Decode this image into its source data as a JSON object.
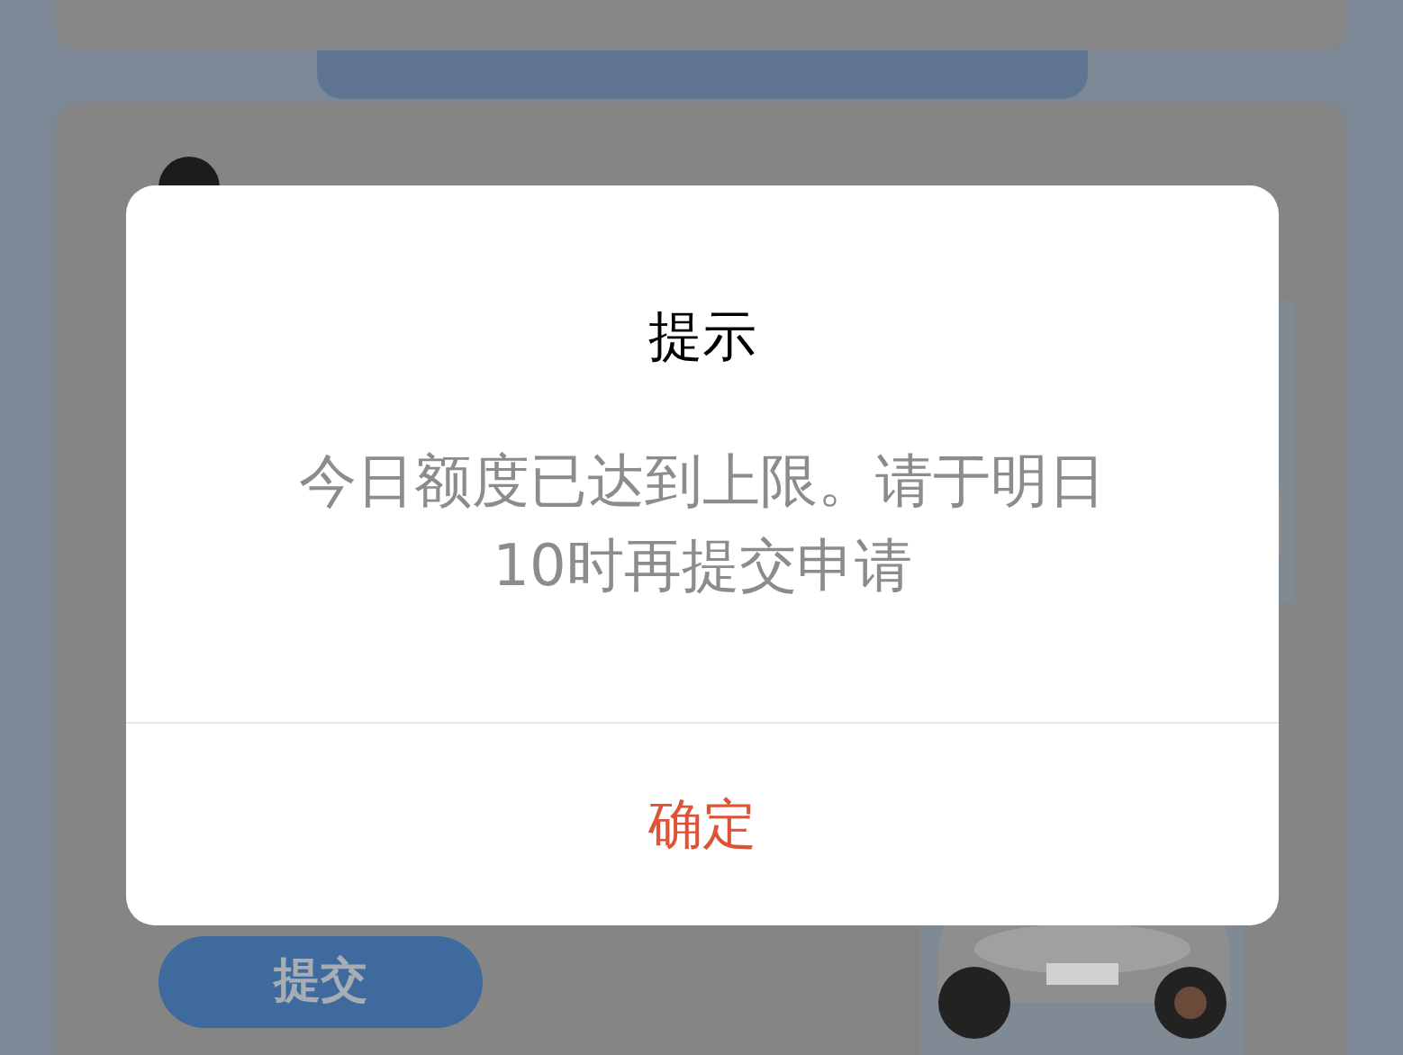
{
  "form_card": {
    "submit_button": "提交"
  },
  "dialog": {
    "title": "提示",
    "message": "今日额度已达到上限。请于明日10时再提交申请",
    "confirm_button": "确定"
  }
}
